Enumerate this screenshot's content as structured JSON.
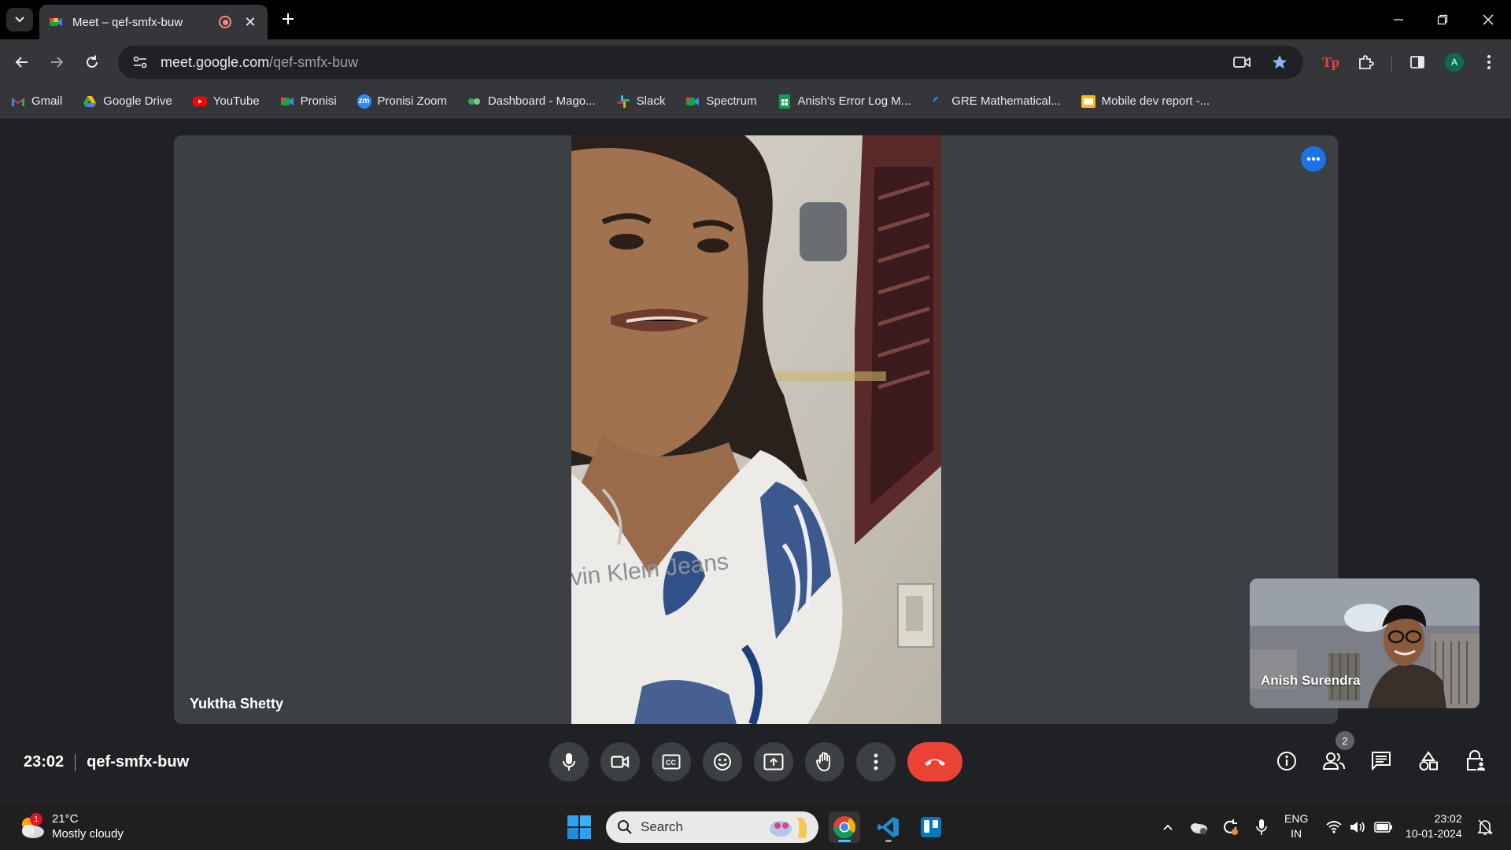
{
  "browser": {
    "tab": {
      "title": "Meet – qef-smfx-buw"
    },
    "url": {
      "host": "meet.google.com",
      "path": "/qef-smfx-buw"
    },
    "bookmarks": [
      {
        "label": "Gmail",
        "icon": "gmail-icon"
      },
      {
        "label": "Google Drive",
        "icon": "drive-icon"
      },
      {
        "label": "YouTube",
        "icon": "youtube-icon"
      },
      {
        "label": "Pronisi",
        "icon": "meet-icon"
      },
      {
        "label": "Pronisi Zoom",
        "icon": "zoom-icon"
      },
      {
        "label": "Dashboard - Mago...",
        "icon": "dashboard-icon"
      },
      {
        "label": "Slack",
        "icon": "slack-icon"
      },
      {
        "label": "Spectrum",
        "icon": "meet-icon"
      },
      {
        "label": "Anish's Error Log M...",
        "icon": "sheets-icon"
      },
      {
        "label": "GRE Mathematical...",
        "icon": "loading-icon"
      },
      {
        "label": "Mobile dev report -...",
        "icon": "slides-icon"
      }
    ],
    "profile_initial": "A",
    "extension_label": "Tp"
  },
  "meet": {
    "main_participant": "Yuktha Shetty",
    "shirt_text": "vin Klein Jeans",
    "self_participant": "Anish Surendra",
    "time": "23:02",
    "meeting_code": "qef-smfx-buw",
    "people_count": "2",
    "accent_color": "#1a73e8",
    "end_call_color": "#ea4335"
  },
  "taskbar": {
    "weather_temp": "21°C",
    "weather_desc": "Mostly cloudy",
    "weather_badge": "1",
    "search_placeholder": "Search",
    "lang_line1": "ENG",
    "lang_line2": "IN",
    "time": "23:02",
    "date": "10-01-2024"
  }
}
